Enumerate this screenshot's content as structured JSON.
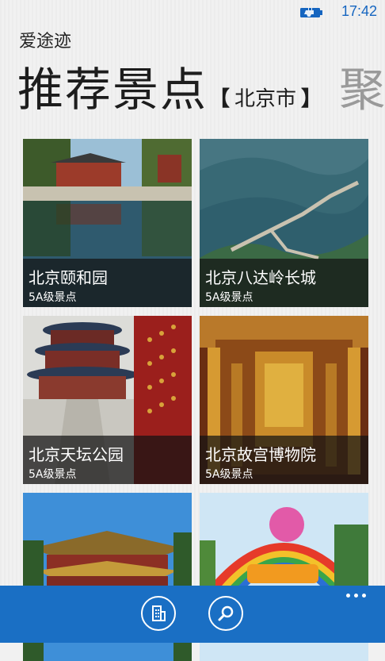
{
  "status_bar": {
    "time": "17:42"
  },
  "app": {
    "title": "爱途迹"
  },
  "pivot": {
    "current": "推荐景点",
    "bracket_open": "【",
    "city": "北京市",
    "bracket_close": "】",
    "next": "聚"
  },
  "attractions": [
    {
      "name": "北京颐和园",
      "level": "5A级景点"
    },
    {
      "name": "北京八达岭长城",
      "level": "5A级景点"
    },
    {
      "name": "北京天坛公园",
      "level": "5A级景点"
    },
    {
      "name": "北京故宫博物院",
      "level": "5A级景点"
    },
    {
      "name": "",
      "level": ""
    },
    {
      "name": "",
      "level": ""
    }
  ],
  "app_bar": {
    "buttons": [
      {
        "icon": "building-icon"
      },
      {
        "icon": "search-icon"
      }
    ],
    "more_icon": "more-ellipsis-icon"
  },
  "colors": {
    "accent": "#1a6fc4",
    "clock": "#1565c0",
    "caption_overlay": "#141414"
  }
}
